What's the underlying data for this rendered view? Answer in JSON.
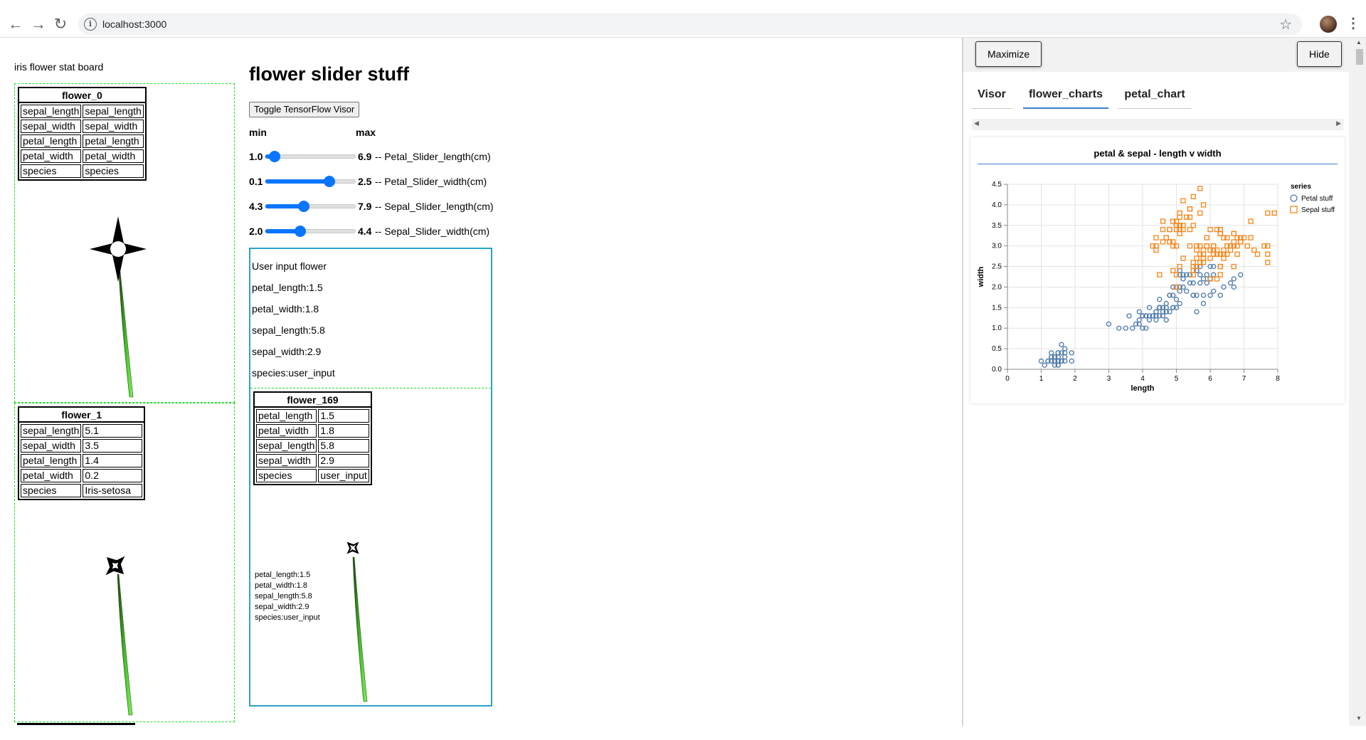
{
  "browser": {
    "url": "localhost:3000"
  },
  "board": {
    "title": "iris flower stat board",
    "flowers": [
      {
        "name": "flower_0",
        "rows": [
          [
            "sepal_length",
            "sepal_length"
          ],
          [
            "sepal_width",
            "sepal_width"
          ],
          [
            "petal_length",
            "petal_length"
          ],
          [
            "petal_width",
            "petal_width"
          ],
          [
            "species",
            "species"
          ]
        ]
      },
      {
        "name": "flower_1",
        "rows": [
          [
            "sepal_length",
            "5.1"
          ],
          [
            "sepal_width",
            "3.5"
          ],
          [
            "petal_length",
            "1.4"
          ],
          [
            "petal_width",
            "0.2"
          ],
          [
            "species",
            "Iris-setosa"
          ]
        ]
      }
    ]
  },
  "main": {
    "title": "flower slider stuff",
    "toggle_button": "Toggle TensorFlow Visor",
    "min_label": "min",
    "max_label": "max",
    "sliders": [
      {
        "min": "1.0",
        "max": "6.9",
        "label": "-- Petal_Slider_length(cm)",
        "fraction": 0.1
      },
      {
        "min": "0.1",
        "max": "2.5",
        "label": "-- Petal_Slider_width(cm)",
        "fraction": 0.7
      },
      {
        "min": "4.3",
        "max": "7.9",
        "label": "-- Sepal_Slider_length(cm)",
        "fraction": 0.42
      },
      {
        "min": "2.0",
        "max": "4.4",
        "label": "-- Sepal_Slider_width(cm)",
        "fraction": 0.38
      }
    ]
  },
  "user_input": {
    "heading": "User input flower",
    "lines": [
      "petal_length:1.5",
      "petal_width:1.8",
      "sepal_length:5.8",
      "sepal_width:2.9",
      "species:user_input"
    ],
    "flower": {
      "name": "flower_169",
      "rows": [
        [
          "petal_length",
          "1.5"
        ],
        [
          "petal_width",
          "1.8"
        ],
        [
          "sepal_length",
          "5.8"
        ],
        [
          "sepal_width",
          "2.9"
        ],
        [
          "species",
          "user_input"
        ]
      ],
      "small_lines": [
        "petal_length:1.5",
        "petal_width:1.8",
        "sepal_length:5.8",
        "sepal_width:2.9",
        "species:user_input"
      ]
    }
  },
  "visor": {
    "maximize_label": "Maximize",
    "hide_label": "Hide",
    "tabs": [
      "Visor",
      "flower_charts",
      "petal_chart"
    ],
    "active_tab": "flower_charts"
  },
  "chart_data": {
    "type": "scatter",
    "title": "petal & sepal - length v width",
    "xlabel": "length",
    "ylabel": "width",
    "xlim": [
      0,
      8
    ],
    "ylim": [
      0,
      4.5
    ],
    "x_ticks": [
      "0",
      "1",
      "2",
      "3",
      "4",
      "5",
      "6",
      "7",
      "8"
    ],
    "y_ticks": [
      "0.0",
      "0.5",
      "1.0",
      "1.5",
      "2.0",
      "2.5",
      "3.0",
      "3.5",
      "4.0",
      "4.5"
    ],
    "grid": true,
    "legend_title": "series",
    "legend_position": "top-right",
    "series": [
      {
        "name": "Petal stuff",
        "marker": "circle",
        "color": "#4c78a8",
        "points": [
          [
            1.4,
            0.2
          ],
          [
            1.3,
            0.2
          ],
          [
            1.5,
            0.2
          ],
          [
            1.4,
            0.2
          ],
          [
            1.7,
            0.4
          ],
          [
            1.4,
            0.3
          ],
          [
            1.5,
            0.2
          ],
          [
            1.5,
            0.1
          ],
          [
            1.5,
            0.2
          ],
          [
            1.6,
            0.2
          ],
          [
            1.4,
            0.1
          ],
          [
            1.1,
            0.1
          ],
          [
            1.2,
            0.2
          ],
          [
            1.5,
            0.4
          ],
          [
            1.3,
            0.4
          ],
          [
            1.4,
            0.3
          ],
          [
            1.7,
            0.3
          ],
          [
            1.5,
            0.3
          ],
          [
            1.7,
            0.2
          ],
          [
            1.5,
            0.4
          ],
          [
            1.0,
            0.2
          ],
          [
            1.7,
            0.5
          ],
          [
            1.9,
            0.2
          ],
          [
            1.6,
            0.2
          ],
          [
            1.6,
            0.4
          ],
          [
            1.5,
            0.2
          ],
          [
            1.4,
            0.2
          ],
          [
            1.6,
            0.2
          ],
          [
            1.5,
            0.1
          ],
          [
            1.5,
            0.2
          ],
          [
            1.2,
            0.2
          ],
          [
            1.3,
            0.2
          ],
          [
            1.3,
            0.3
          ],
          [
            1.3,
            0.3
          ],
          [
            1.6,
            0.6
          ],
          [
            1.9,
            0.4
          ],
          [
            1.4,
            0.3
          ],
          [
            1.6,
            0.2
          ],
          [
            1.4,
            0.2
          ],
          [
            1.5,
            0.2
          ],
          [
            4.7,
            1.4
          ],
          [
            4.5,
            1.5
          ],
          [
            4.9,
            1.5
          ],
          [
            4.0,
            1.3
          ],
          [
            4.6,
            1.5
          ],
          [
            4.5,
            1.3
          ],
          [
            4.7,
            1.6
          ],
          [
            3.3,
            1.0
          ],
          [
            4.6,
            1.3
          ],
          [
            3.9,
            1.4
          ],
          [
            3.5,
            1.0
          ],
          [
            4.2,
            1.5
          ],
          [
            4.0,
            1.0
          ],
          [
            4.7,
            1.4
          ],
          [
            3.6,
            1.3
          ],
          [
            4.4,
            1.4
          ],
          [
            4.5,
            1.5
          ],
          [
            4.1,
            1.0
          ],
          [
            4.5,
            1.5
          ],
          [
            3.9,
            1.1
          ],
          [
            4.8,
            1.8
          ],
          [
            4.0,
            1.3
          ],
          [
            4.9,
            1.5
          ],
          [
            4.7,
            1.2
          ],
          [
            4.3,
            1.3
          ],
          [
            4.4,
            1.4
          ],
          [
            4.8,
            1.4
          ],
          [
            5.0,
            1.7
          ],
          [
            4.5,
            1.5
          ],
          [
            3.8,
            1.1
          ],
          [
            3.7,
            1.0
          ],
          [
            3.9,
            1.2
          ],
          [
            5.1,
            1.6
          ],
          [
            4.5,
            1.5
          ],
          [
            4.7,
            1.5
          ],
          [
            4.4,
            1.3
          ],
          [
            4.1,
            1.3
          ],
          [
            4.0,
            1.3
          ],
          [
            4.4,
            1.2
          ],
          [
            4.6,
            1.4
          ],
          [
            4.2,
            1.2
          ],
          [
            4.2,
            1.3
          ],
          [
            4.3,
            1.3
          ],
          [
            3.0,
            1.1
          ],
          [
            4.1,
            1.3
          ],
          [
            6.0,
            2.5
          ],
          [
            5.1,
            1.9
          ],
          [
            5.9,
            2.1
          ],
          [
            5.6,
            1.8
          ],
          [
            5.8,
            2.2
          ],
          [
            6.6,
            2.1
          ],
          [
            4.5,
            1.7
          ],
          [
            6.3,
            1.8
          ],
          [
            5.8,
            1.8
          ],
          [
            6.1,
            2.5
          ],
          [
            5.1,
            2.0
          ],
          [
            5.3,
            1.9
          ],
          [
            5.5,
            2.1
          ],
          [
            5.0,
            2.0
          ],
          [
            5.1,
            2.4
          ],
          [
            5.3,
            2.3
          ],
          [
            5.5,
            1.8
          ],
          [
            6.7,
            2.2
          ],
          [
            6.9,
            2.3
          ],
          [
            5.0,
            1.5
          ],
          [
            5.7,
            2.3
          ],
          [
            4.9,
            2.0
          ],
          [
            6.7,
            2.0
          ],
          [
            4.9,
            1.8
          ],
          [
            5.7,
            2.1
          ],
          [
            6.0,
            1.8
          ],
          [
            4.8,
            1.8
          ],
          [
            5.8,
            1.6
          ],
          [
            6.4,
            2.0
          ],
          [
            6.1,
            1.9
          ],
          [
            5.6,
            1.4
          ],
          [
            6.1,
            2.3
          ],
          [
            5.6,
            2.4
          ],
          [
            5.5,
            1.8
          ],
          [
            5.4,
            2.1
          ],
          [
            5.6,
            2.4
          ],
          [
            5.1,
            2.3
          ],
          [
            5.9,
            2.3
          ],
          [
            5.7,
            2.5
          ],
          [
            5.2,
            2.3
          ],
          [
            5.2,
            2.0
          ],
          [
            5.4,
            2.3
          ],
          [
            6.0,
            2.2
          ],
          [
            5.2,
            2.2
          ]
        ]
      },
      {
        "name": "Sepal stuff",
        "marker": "square",
        "color": "#f58518",
        "points": [
          [
            5.1,
            3.5
          ],
          [
            4.9,
            3.0
          ],
          [
            4.7,
            3.2
          ],
          [
            4.6,
            3.1
          ],
          [
            5.0,
            3.6
          ],
          [
            5.4,
            3.9
          ],
          [
            4.6,
            3.4
          ],
          [
            5.0,
            3.4
          ],
          [
            4.4,
            2.9
          ],
          [
            4.9,
            3.1
          ],
          [
            5.4,
            3.7
          ],
          [
            4.8,
            3.4
          ],
          [
            4.3,
            3.0
          ],
          [
            5.8,
            4.0
          ],
          [
            5.7,
            4.4
          ],
          [
            5.4,
            3.9
          ],
          [
            5.1,
            3.5
          ],
          [
            5.7,
            3.8
          ],
          [
            5.1,
            3.8
          ],
          [
            5.4,
            3.4
          ],
          [
            5.1,
            3.7
          ],
          [
            4.6,
            3.6
          ],
          [
            5.1,
            3.3
          ],
          [
            4.8,
            3.4
          ],
          [
            5.0,
            3.0
          ],
          [
            5.2,
            3.5
          ],
          [
            5.2,
            3.4
          ],
          [
            4.7,
            3.2
          ],
          [
            4.8,
            3.1
          ],
          [
            5.5,
            4.2
          ],
          [
            5.2,
            4.1
          ],
          [
            5.5,
            3.5
          ],
          [
            4.9,
            3.6
          ],
          [
            4.4,
            3.0
          ],
          [
            5.1,
            3.4
          ],
          [
            5.0,
            3.5
          ],
          [
            4.5,
            2.3
          ],
          [
            4.4,
            3.2
          ],
          [
            5.0,
            3.5
          ],
          [
            5.3,
            3.7
          ],
          [
            7.0,
            3.2
          ],
          [
            6.4,
            3.2
          ],
          [
            6.9,
            3.1
          ],
          [
            5.5,
            2.3
          ],
          [
            6.5,
            2.8
          ],
          [
            5.7,
            2.8
          ],
          [
            6.3,
            3.3
          ],
          [
            4.9,
            2.4
          ],
          [
            6.6,
            2.9
          ],
          [
            5.2,
            2.7
          ],
          [
            5.0,
            2.0
          ],
          [
            5.9,
            3.0
          ],
          [
            6.0,
            2.2
          ],
          [
            6.1,
            2.9
          ],
          [
            5.6,
            2.9
          ],
          [
            6.7,
            3.1
          ],
          [
            5.8,
            2.7
          ],
          [
            6.2,
            2.2
          ],
          [
            5.6,
            2.5
          ],
          [
            5.9,
            3.2
          ],
          [
            6.3,
            2.5
          ],
          [
            6.1,
            2.8
          ],
          [
            6.4,
            2.9
          ],
          [
            6.6,
            3.0
          ],
          [
            6.8,
            2.8
          ],
          [
            6.7,
            3.0
          ],
          [
            6.0,
            2.9
          ],
          [
            5.7,
            2.6
          ],
          [
            5.5,
            2.4
          ],
          [
            5.8,
            2.7
          ],
          [
            6.0,
            2.7
          ],
          [
            5.4,
            3.0
          ],
          [
            6.0,
            3.4
          ],
          [
            6.3,
            2.3
          ],
          [
            5.6,
            3.0
          ],
          [
            5.5,
            2.5
          ],
          [
            5.5,
            2.6
          ],
          [
            6.1,
            3.0
          ],
          [
            5.8,
            2.6
          ],
          [
            5.0,
            2.3
          ],
          [
            5.6,
            2.7
          ],
          [
            5.7,
            3.0
          ],
          [
            6.2,
            2.9
          ],
          [
            5.1,
            2.5
          ],
          [
            6.3,
            3.3
          ],
          [
            7.1,
            3.0
          ],
          [
            6.5,
            3.0
          ],
          [
            7.6,
            3.0
          ],
          [
            7.3,
            2.9
          ],
          [
            6.7,
            2.5
          ],
          [
            7.2,
            3.6
          ],
          [
            6.5,
            3.2
          ],
          [
            6.4,
            2.7
          ],
          [
            6.8,
            3.0
          ],
          [
            5.8,
            2.8
          ],
          [
            7.7,
            3.8
          ],
          [
            7.7,
            2.6
          ],
          [
            6.9,
            3.2
          ],
          [
            7.7,
            2.8
          ],
          [
            6.7,
            3.3
          ],
          [
            7.2,
            3.2
          ],
          [
            6.2,
            2.8
          ],
          [
            6.1,
            3.0
          ],
          [
            7.4,
            2.8
          ],
          [
            7.9,
            3.8
          ],
          [
            6.4,
            2.8
          ],
          [
            6.3,
            2.8
          ],
          [
            7.7,
            3.0
          ],
          [
            6.3,
            3.4
          ],
          [
            6.9,
            3.1
          ],
          [
            5.8,
            2.7
          ],
          [
            6.8,
            3.2
          ],
          [
            6.7,
            3.3
          ],
          [
            6.3,
            2.5
          ],
          [
            6.2,
            3.4
          ],
          [
            5.9,
            3.0
          ],
          [
            5.8,
            2.9
          ]
        ]
      }
    ]
  }
}
